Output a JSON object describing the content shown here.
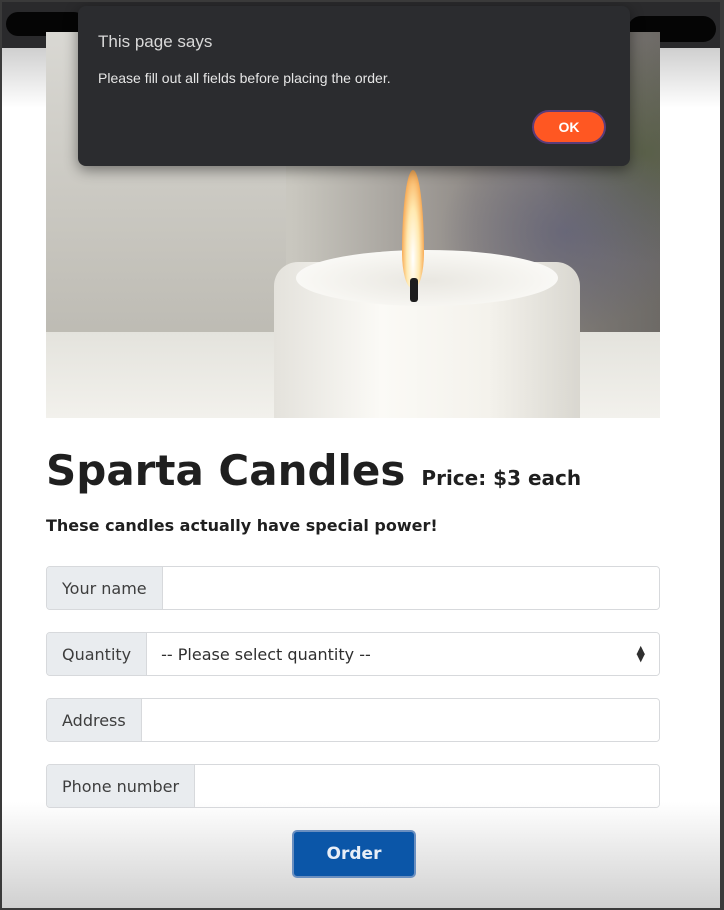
{
  "dialog": {
    "title": "This page says",
    "message": "Please fill out all fields before placing the order.",
    "ok_label": "OK"
  },
  "page": {
    "title": "Sparta Candles",
    "price": "Price: $3 each",
    "subtitle": "These candles actually have special power!"
  },
  "form": {
    "name_label": "Your name",
    "quantity_label": "Quantity",
    "quantity_selected": "-- Please select quantity --",
    "address_label": "Address",
    "phone_label": "Phone number",
    "order_label": "Order"
  },
  "colors": {
    "ok_button": "#ff5722",
    "order_button": "#0b56a8",
    "dialog_bg": "#2b2c2f"
  }
}
